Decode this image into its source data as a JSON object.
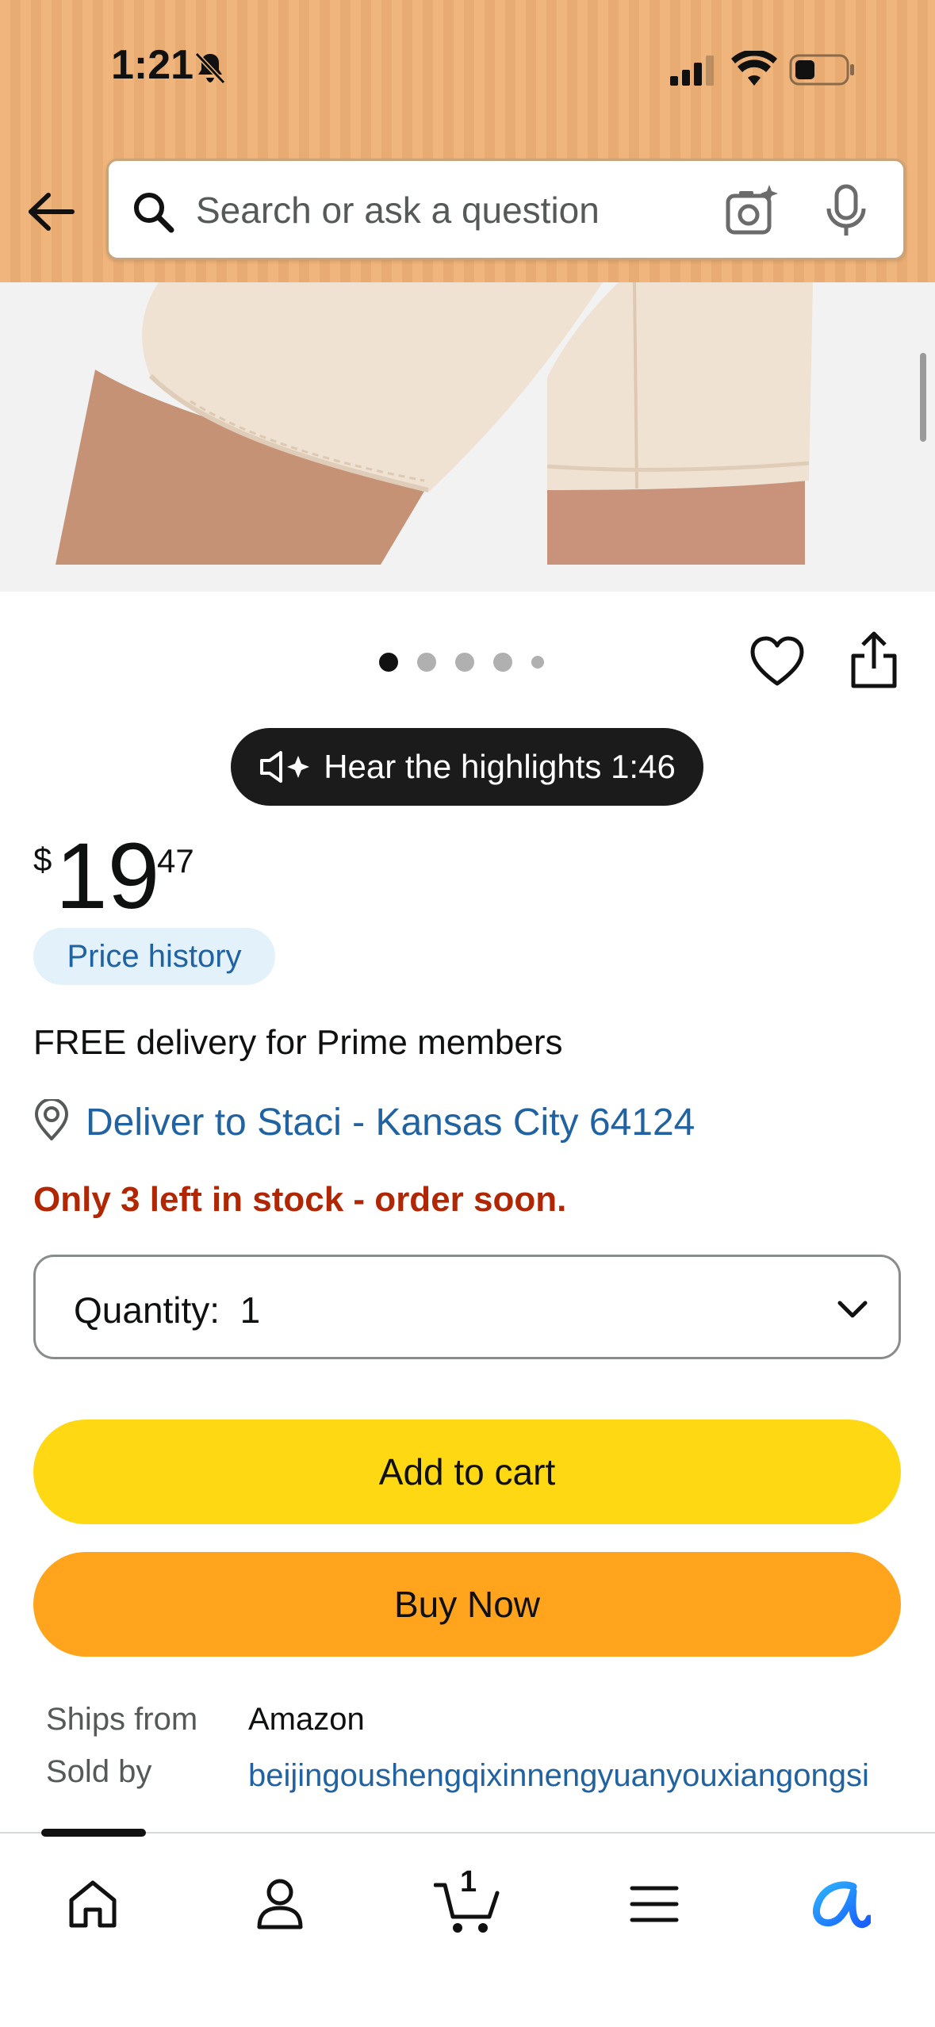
{
  "status_bar": {
    "time": "1:21"
  },
  "search": {
    "placeholder": "Search or ask a question"
  },
  "gallery": {
    "image_count": 5,
    "active_index": 0
  },
  "highlights": {
    "label": "Hear the highlights 1:46"
  },
  "price": {
    "symbol": "$",
    "whole": "19",
    "fraction": "47"
  },
  "price_history_label": "Price history",
  "delivery": {
    "free_text": "FREE delivery for Prime members",
    "deliver_to": "Deliver to Staci - Kansas City 64124"
  },
  "stock_text": "Only 3 left in stock - order soon.",
  "quantity_label": "Quantity:  1",
  "buttons": {
    "add_to_cart": "Add to cart",
    "buy_now": "Buy Now"
  },
  "seller_info": {
    "ships_from_label": "Ships from",
    "ships_from_value": "Amazon",
    "sold_by_label": "Sold by",
    "sold_by_value": "beijingoushengqixinnengyuanyouxiangongsi"
  },
  "bottom_nav": {
    "cart_count": "1",
    "items": [
      "home-icon",
      "account-icon",
      "cart-icon",
      "menu-icon",
      "rufus-icon"
    ]
  },
  "colors": {
    "header_bg": "#efb57c",
    "link_blue": "#2162a1",
    "stock_red": "#b12704",
    "add_to_cart_yellow": "#ffd814",
    "buy_now_orange": "#ffa41c"
  }
}
